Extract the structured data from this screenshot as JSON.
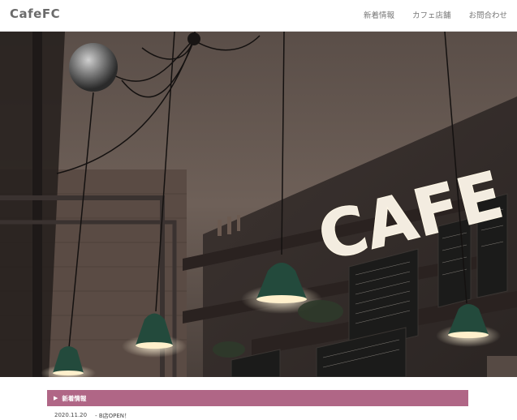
{
  "header": {
    "logo": "CafeFC",
    "nav": [
      {
        "label": "新着情報"
      },
      {
        "label": "カフェ店舗"
      },
      {
        "label": "お問合わせ"
      }
    ]
  },
  "hero": {
    "sign_text": "CAFE"
  },
  "news": {
    "heading": "新着情報",
    "items": [
      {
        "date": "2020.11.20",
        "text": "- B店OPEN！"
      }
    ]
  },
  "colors": {
    "accent": "#b06686",
    "header_text": "#6b6b6b"
  }
}
